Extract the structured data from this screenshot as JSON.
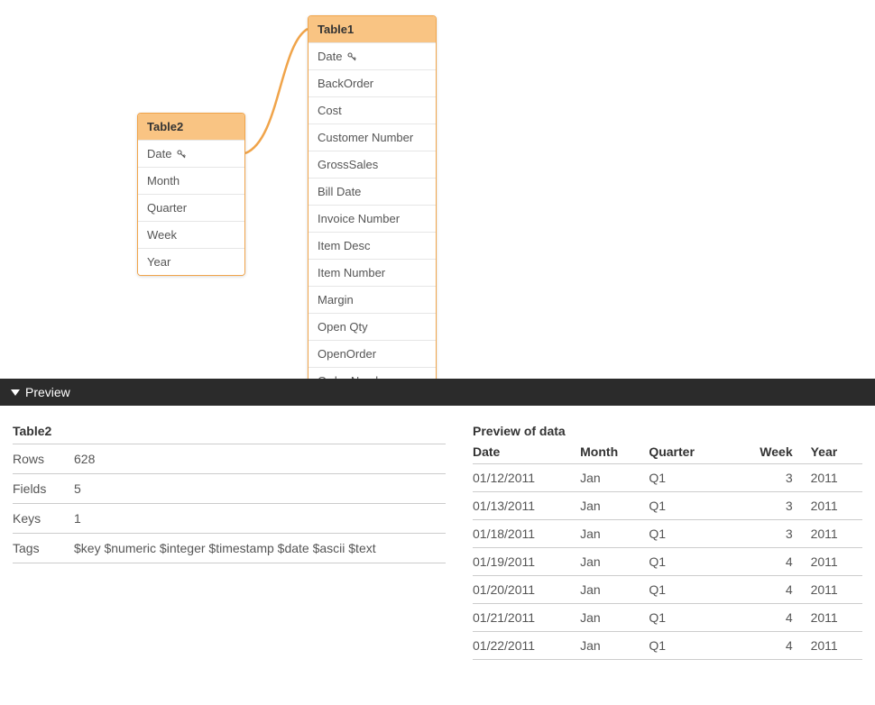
{
  "diagram": {
    "table1": {
      "name": "Table1",
      "fields": [
        {
          "label": "Date",
          "key": true
        },
        {
          "label": "BackOrder"
        },
        {
          "label": "Cost"
        },
        {
          "label": "Customer Number"
        },
        {
          "label": "GrossSales"
        },
        {
          "label": "Bill Date"
        },
        {
          "label": "Invoice Number"
        },
        {
          "label": "Item Desc"
        },
        {
          "label": "Item Number"
        },
        {
          "label": "Margin"
        },
        {
          "label": "Open Qty"
        },
        {
          "label": "OpenOrder"
        },
        {
          "label": "Order Number"
        }
      ]
    },
    "table2": {
      "name": "Table2",
      "fields": [
        {
          "label": "Date",
          "key": true
        },
        {
          "label": "Month"
        },
        {
          "label": "Quarter"
        },
        {
          "label": "Week"
        },
        {
          "label": "Year"
        }
      ]
    }
  },
  "preview": {
    "title": "Preview",
    "meta": {
      "table_name": "Table2",
      "rows_label": "Rows",
      "rows_value": "628",
      "fields_label": "Fields",
      "fields_value": "5",
      "keys_label": "Keys",
      "keys_value": "1",
      "tags_label": "Tags",
      "tags_value": "$key $numeric $integer $timestamp $date $ascii $text"
    },
    "data": {
      "title": "Preview of data",
      "columns": [
        "Date",
        "Month",
        "Quarter",
        "Week",
        "Year"
      ],
      "rows": [
        [
          "01/12/2011",
          "Jan",
          "Q1",
          "3",
          "2011"
        ],
        [
          "01/13/2011",
          "Jan",
          "Q1",
          "3",
          "2011"
        ],
        [
          "01/18/2011",
          "Jan",
          "Q1",
          "3",
          "2011"
        ],
        [
          "01/19/2011",
          "Jan",
          "Q1",
          "4",
          "2011"
        ],
        [
          "01/20/2011",
          "Jan",
          "Q1",
          "4",
          "2011"
        ],
        [
          "01/21/2011",
          "Jan",
          "Q1",
          "4",
          "2011"
        ],
        [
          "01/22/2011",
          "Jan",
          "Q1",
          "4",
          "2011"
        ]
      ]
    }
  }
}
